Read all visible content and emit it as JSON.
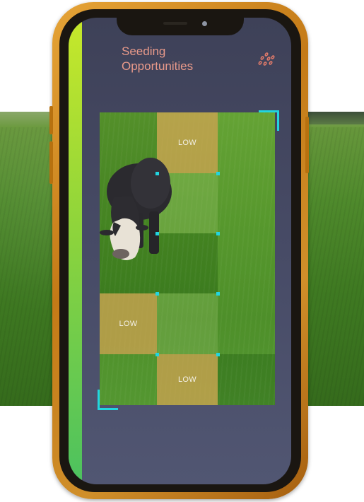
{
  "app": {
    "title_line1": "Seeding",
    "title_line2": "Opportunities",
    "header_icon": "seeds-icon"
  },
  "grid": {
    "columns": 3,
    "rows": 5,
    "cells": [
      {
        "row": 0,
        "col": 0,
        "level": "dark",
        "label": ""
      },
      {
        "row": 0,
        "col": 1,
        "level": "low",
        "label": "LOW"
      },
      {
        "row": 0,
        "col": 2,
        "level": "light",
        "label": ""
      },
      {
        "row": 1,
        "col": 0,
        "level": "dark",
        "label": ""
      },
      {
        "row": 1,
        "col": 1,
        "level": "med",
        "label": ""
      },
      {
        "row": 1,
        "col": 2,
        "level": "light",
        "label": ""
      },
      {
        "row": 2,
        "col": 0,
        "level": "dark",
        "label": ""
      },
      {
        "row": 2,
        "col": 1,
        "level": "dark",
        "label": ""
      },
      {
        "row": 2,
        "col": 2,
        "level": "light",
        "label": ""
      },
      {
        "row": 3,
        "col": 0,
        "level": "low",
        "label": "LOW"
      },
      {
        "row": 3,
        "col": 1,
        "level": "med",
        "label": ""
      },
      {
        "row": 3,
        "col": 2,
        "level": "light",
        "label": ""
      },
      {
        "row": 4,
        "col": 0,
        "level": "light",
        "label": ""
      },
      {
        "row": 4,
        "col": 1,
        "level": "low",
        "label": "LOW"
      },
      {
        "row": 4,
        "col": 2,
        "level": "dark",
        "label": ""
      }
    ]
  },
  "colors": {
    "title": "#e99a8a",
    "accent": "#22d5e0",
    "screen_bg": "#474b66",
    "low": "#cea552",
    "frame": "#d08f2a"
  }
}
